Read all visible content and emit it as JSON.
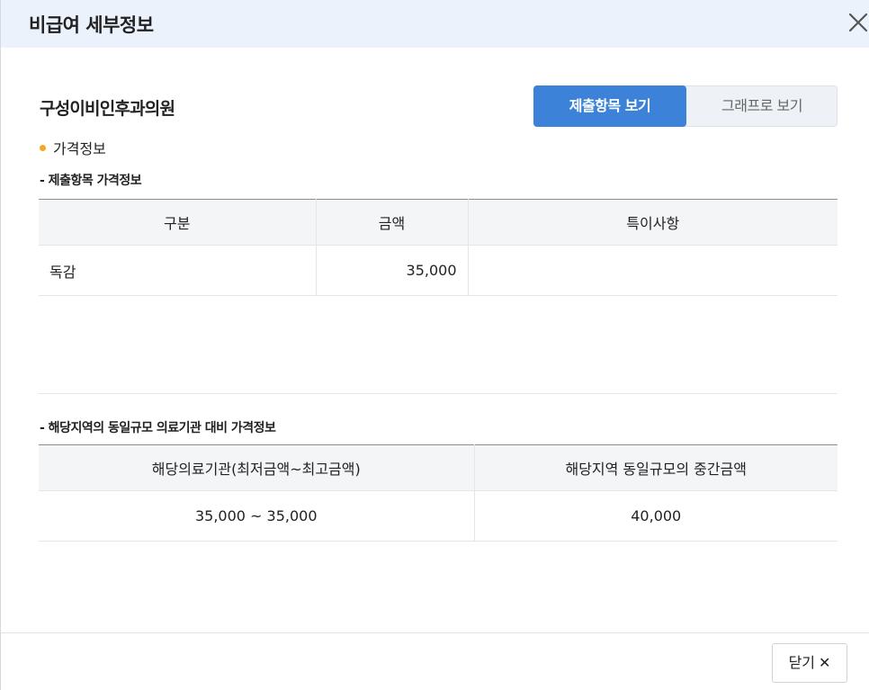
{
  "header": {
    "title": "비급여 세부정보"
  },
  "hospital": {
    "name": "구성이비인후과의원"
  },
  "toggle": {
    "submitted_label": "제출항목 보기",
    "graph_label": "그래프로 보기"
  },
  "section": {
    "title": "가격정보"
  },
  "submitted": {
    "subtitle": "- 제출항목 가격정보",
    "headers": [
      "구분",
      "금액",
      "특이사항"
    ],
    "rows": [
      {
        "category": "독감",
        "amount": "35,000",
        "note": ""
      }
    ]
  },
  "regional": {
    "subtitle": "- 해당지역의 동일규모 의료기관 대비 가격정보",
    "headers": [
      "해당의료기관(최저금액~최고금액)",
      "해당지역 동일규모의 중간금액"
    ],
    "rows": [
      {
        "range": "35,000 ~ 35,000",
        "median": "40,000"
      }
    ]
  },
  "footer": {
    "close_label": "닫기",
    "close_symbol": "✕"
  }
}
